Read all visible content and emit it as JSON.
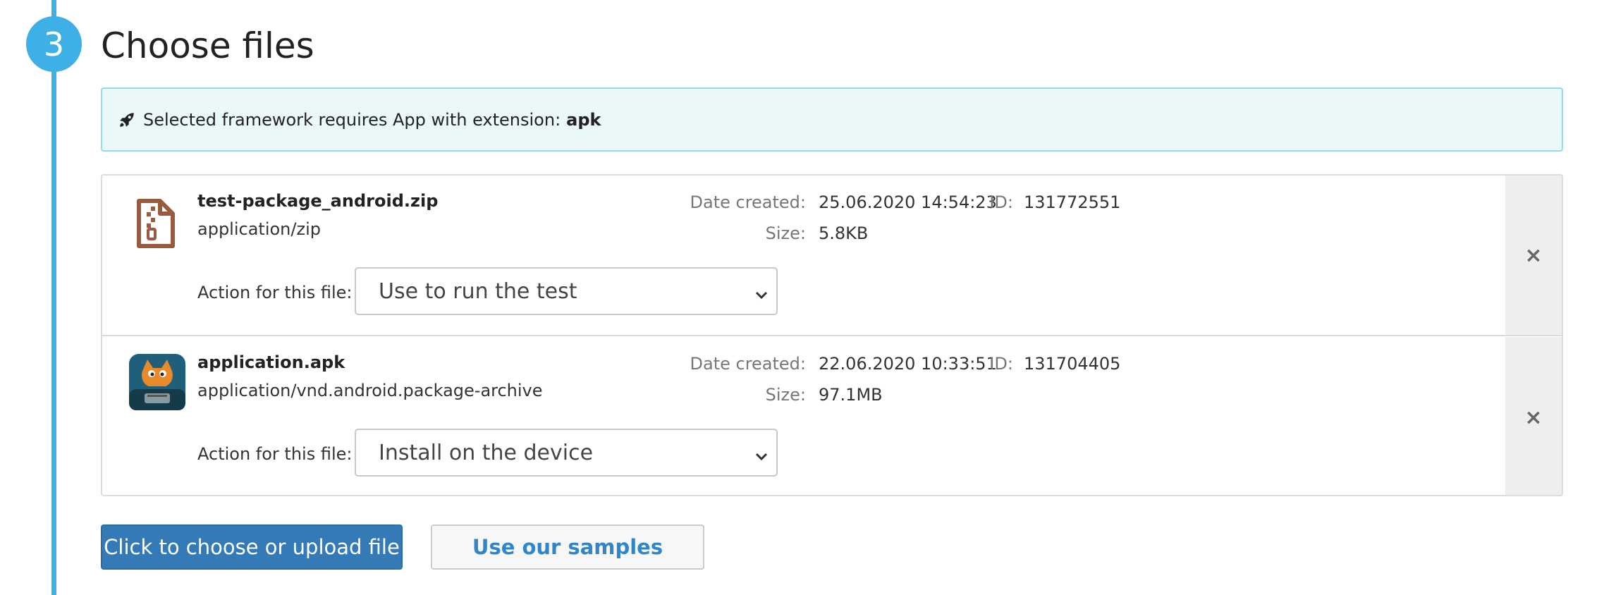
{
  "step": {
    "number": "3",
    "title": "Choose files"
  },
  "alert": {
    "text": "Selected framework requires App with extension:",
    "extension": "apk"
  },
  "labels": {
    "date_created": "Date created:",
    "id": "ID:",
    "size": "Size:",
    "action": "Action for this file:"
  },
  "files": [
    {
      "name": "test-package_android.zip",
      "mime": "application/zip",
      "date": "25.06.2020 14:54:23",
      "id": "131772551",
      "size": "5.8KB",
      "action": "Use to run the test",
      "icon": "zip-file-icon"
    },
    {
      "name": "application.apk",
      "mime": "application/vnd.android.package-archive",
      "date": "22.06.2020 10:33:51",
      "id": "131704405",
      "size": "97.1MB",
      "action": "Install on the device",
      "icon": "app-icon"
    }
  ],
  "remove_symbol": "×",
  "buttons": {
    "upload": "Click to choose or upload file",
    "samples": "Use our samples"
  },
  "colors": {
    "accent": "#3fb0e6",
    "primary": "#337ab7",
    "alert_bg": "#ebf8fa",
    "alert_border": "#94dbe7"
  }
}
